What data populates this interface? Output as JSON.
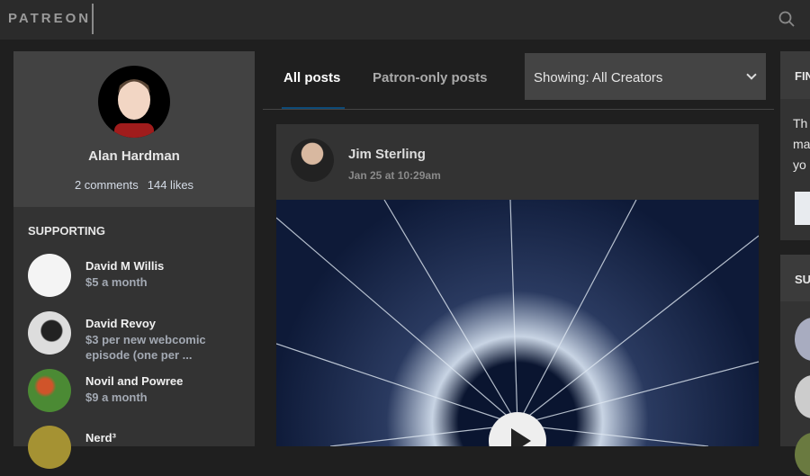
{
  "header": {
    "logo": "PATREON"
  },
  "profile": {
    "name": "Alan Hardman",
    "comments": "2 comments",
    "likes": "144 likes"
  },
  "supporting": {
    "title": "SUPPORTING",
    "items": [
      {
        "name": "David M Willis",
        "price": "$5 a month"
      },
      {
        "name": "David Revoy",
        "price": "$3 per new webcomic episode (one per ..."
      },
      {
        "name": "Novil and Powree",
        "price": "$9 a month"
      },
      {
        "name": "Nerd³",
        "price": ""
      }
    ]
  },
  "tabs": [
    {
      "label": "All posts"
    },
    {
      "label": "Patron-only posts"
    }
  ],
  "filter": {
    "value": "Showing: All Creators"
  },
  "post": {
    "author": "Jim Sterling",
    "date": "Jan 25 at 10:29am"
  },
  "right": {
    "card1_title": "FIN",
    "card1_text": "Th\nma\nyo",
    "card2_title": "SU"
  }
}
